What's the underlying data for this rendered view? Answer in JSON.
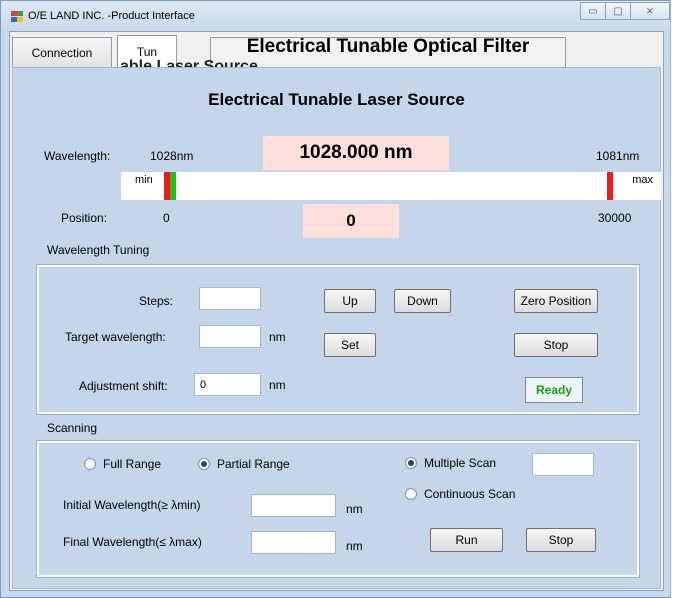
{
  "window": {
    "title": "O/E LAND INC. -Product Interface",
    "controls": {
      "minimize": "▭",
      "maximize": "▢",
      "close": "⨯"
    }
  },
  "tabs": {
    "connection": "Connection",
    "tunable": "Tun",
    "filter": "Electrical Tunable Optical Filter",
    "ghost": "able Laser Source"
  },
  "laser": {
    "heading": "Electrical Tunable Laser Source",
    "wavelength_label": "Wavelength:",
    "wavelength_min": "1028nm",
    "wavelength_max": "1081nm",
    "wavelength_value": "1028.000  nm",
    "slider_min_label": "min",
    "slider_max_label": "max",
    "position_label": "Position:",
    "position_min": "0",
    "position_max": "30000",
    "position_value": "0"
  },
  "tuning": {
    "section_title": "Wavelength Tuning",
    "steps_label": "Steps:",
    "steps_value": "",
    "target_label": "Target wavelength:",
    "target_value": "",
    "target_unit": "nm",
    "shift_label": "Adjustment shift:",
    "shift_value": "0",
    "shift_unit": "nm",
    "up": "Up",
    "down": "Down",
    "zero": "Zero Position",
    "set": "Set",
    "stop": "Stop",
    "status": "Ready",
    "status_color": "#13a313"
  },
  "scanning": {
    "section_title": "Scanning",
    "full_range": "Full Range",
    "partial_range": "Partial Range",
    "multiple_scan": "Multiple  Scan",
    "continuous_scan": "Continuous  Scan",
    "multiple_count": "",
    "initial_label": "Initial Wavelength(≥ λmin)",
    "initial_value": "",
    "initial_unit": "nm",
    "final_label": "Final  Wavelength(≤ λmax)",
    "final_value": "",
    "final_unit": "nm",
    "run": "Run",
    "stop": "Stop",
    "selected_range": "Partial Range",
    "selected_mode": "Multiple Scan"
  },
  "colors": {
    "window_bg": "#c5d6ea",
    "value_box_bg": "#fde0dc",
    "slider_red": "#ee1c1c",
    "slider_green": "#21c01c"
  }
}
